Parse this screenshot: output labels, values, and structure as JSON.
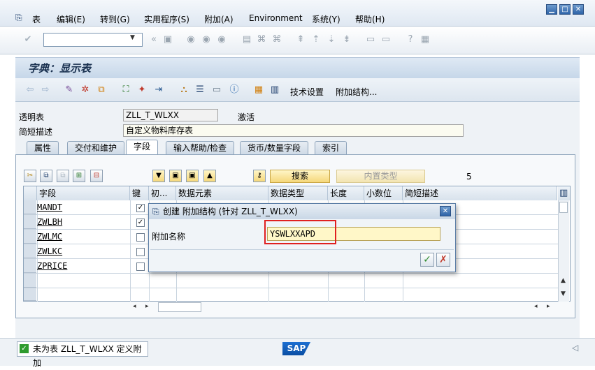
{
  "menubar": {
    "items": [
      "表",
      "编辑(E)",
      "转到(G)",
      "实用程序(S)",
      "附加(A)",
      "Environment",
      "系统(Y)",
      "帮助(H)"
    ]
  },
  "screen": {
    "title": "字典：显示表"
  },
  "app_toolbar": {
    "tech_settings": "技术设置",
    "append_structure": "附加结构..."
  },
  "header": {
    "table_type_label": "透明表",
    "table_name": "ZLL_T_WLXX",
    "status": "激活",
    "short_desc_label": "简短描述",
    "short_desc": "自定义物料库存表"
  },
  "tabs": [
    "属性",
    "交付和维护",
    "字段",
    "输入帮助/检查",
    "货币/数量字段",
    "索引"
  ],
  "fields_toolbar": {
    "search_label": "搜索",
    "builtin_type_label": "内置类型",
    "count": "5"
  },
  "table": {
    "columns": [
      "字段",
      "键",
      "初...",
      "数据元素",
      "数据类型",
      "长度",
      "小数位",
      "简短描述"
    ],
    "rows": [
      {
        "field": "MANDT",
        "key": "✓"
      },
      {
        "field": "ZWLBH",
        "key": "✓"
      },
      {
        "field": "ZWLMC",
        "key": ""
      },
      {
        "field": "ZWLKC",
        "key": ""
      },
      {
        "field": "ZPRICE",
        "key": ""
      }
    ]
  },
  "dialog": {
    "title": "创建 附加结构 (针对 ZLL_T_WLXX)",
    "name_label": "附加名称",
    "name_value": "YSWLXXAPD"
  },
  "statusbar": {
    "message": "未为表 ZLL_T_WLXX 定义附加",
    "logo": "SAP"
  },
  "colors": {
    "accent": "#2f64a8",
    "highlight_box": "#e02020",
    "input_bg": "#fff7c8"
  }
}
